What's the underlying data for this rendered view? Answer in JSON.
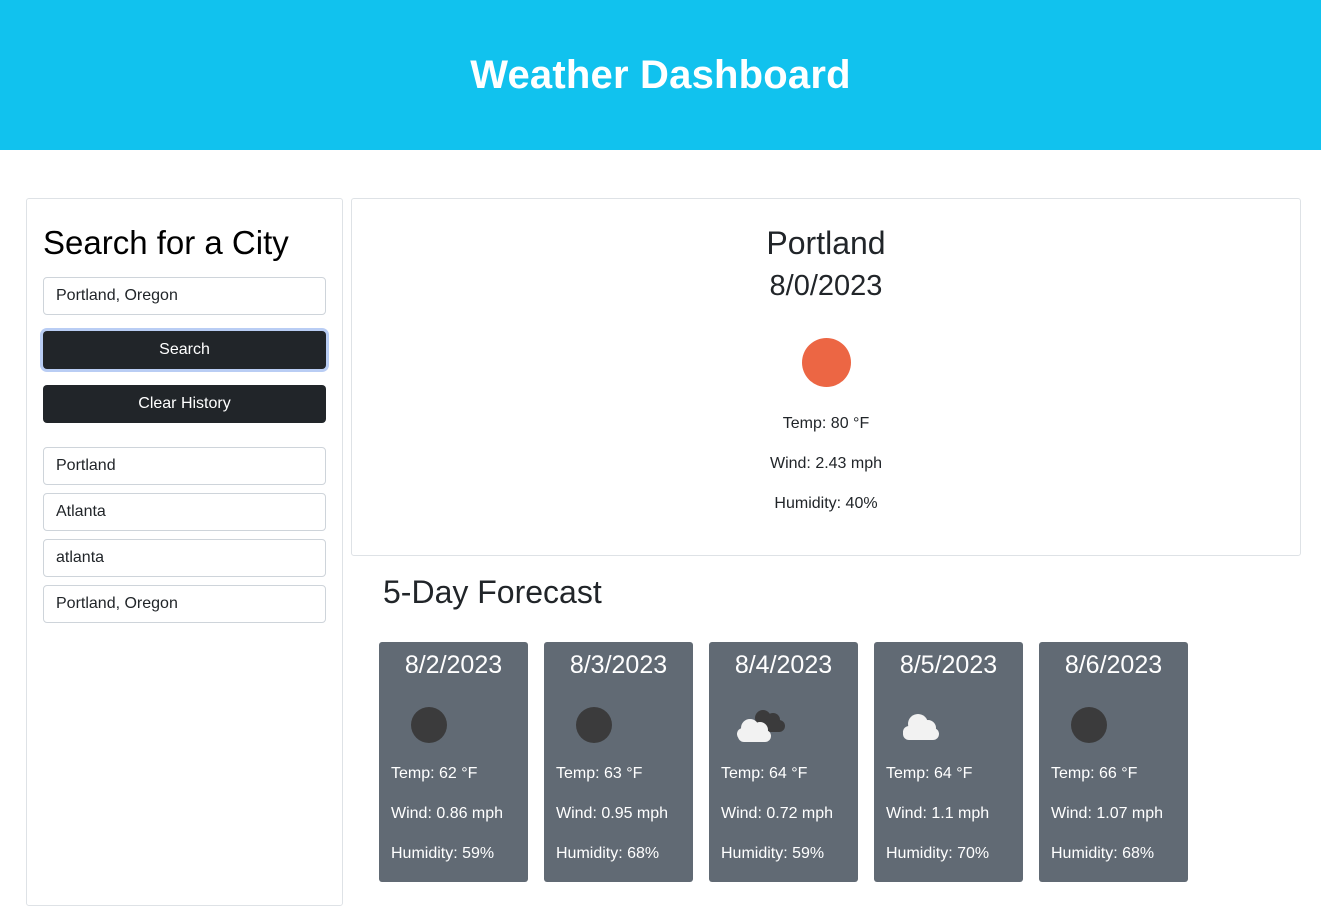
{
  "header": {
    "title": "Weather Dashboard"
  },
  "sidebar": {
    "heading": "Search for a City",
    "search_input": {
      "value": "Portland, Oregon",
      "placeholder": ""
    },
    "search_button": "Search",
    "clear_button": "Clear History",
    "history": [
      "Portland",
      "Atlanta",
      "atlanta",
      "Portland, Oregon"
    ]
  },
  "current": {
    "city": "Portland",
    "date": "8/0/2023",
    "icon": "sun-icon",
    "temp": "Temp: 80 °F",
    "wind": "Wind: 2.43 mph",
    "humidity": "Humidity: 40%"
  },
  "forecast": {
    "title": "5-Day Forecast",
    "days": [
      {
        "date": "8/2/2023",
        "icon": "moon-icon",
        "temp": "Temp: 62 °F",
        "wind": "Wind: 0.86 mph",
        "humidity": "Humidity: 59%"
      },
      {
        "date": "8/3/2023",
        "icon": "moon-icon",
        "temp": "Temp: 63 °F",
        "wind": "Wind: 0.95 mph",
        "humidity": "Humidity: 68%"
      },
      {
        "date": "8/4/2023",
        "icon": "clouds-icon",
        "temp": "Temp: 64 °F",
        "wind": "Wind: 0.72 mph",
        "humidity": "Humidity: 59%"
      },
      {
        "date": "8/5/2023",
        "icon": "cloud-icon",
        "temp": "Temp: 64 °F",
        "wind": "Wind: 1.1 mph",
        "humidity": "Humidity: 70%"
      },
      {
        "date": "8/6/2023",
        "icon": "moon-icon",
        "temp": "Temp: 66 °F",
        "wind": "Wind: 1.07 mph",
        "humidity": "Humidity: 68%"
      }
    ]
  },
  "colors": {
    "header_bg": "#11c2ee",
    "button_dark": "#212529",
    "card_bg": "#616a74",
    "sun": "#ec6644"
  }
}
